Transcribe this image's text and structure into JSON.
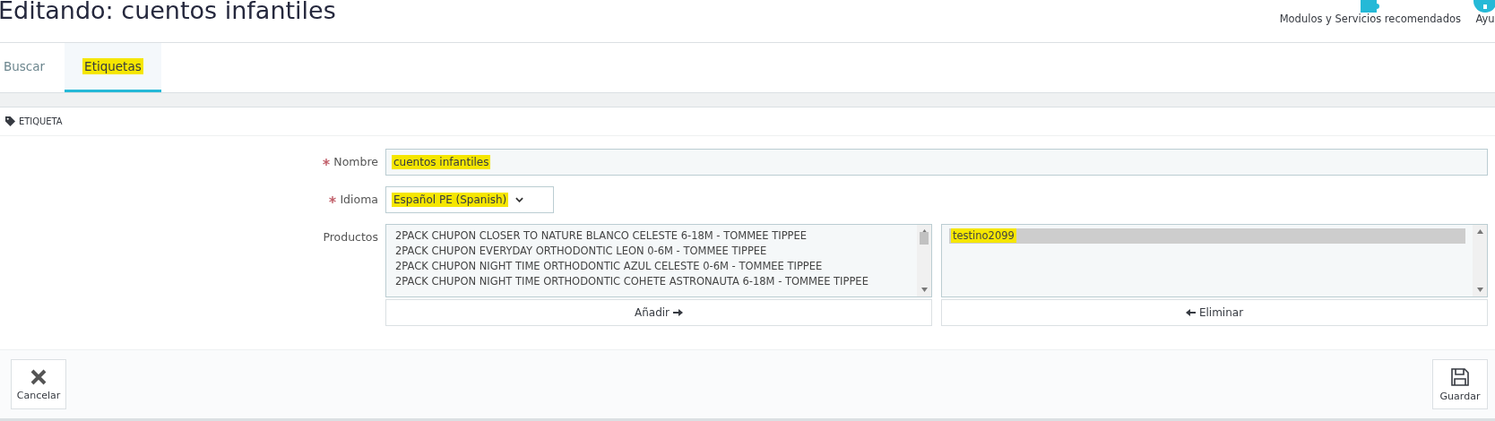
{
  "page_title": "Editando: cuentos infantiles",
  "toolbar": [
    {
      "kind": "puzzle",
      "label": "Modulos y Servicios recomendados"
    },
    {
      "kind": "help",
      "label": "Ayu"
    }
  ],
  "tabs": [
    {
      "label": "Buscar",
      "selected": false,
      "highlighted": false
    },
    {
      "label": "Etiquetas",
      "selected": true,
      "highlighted": true
    }
  ],
  "panel": {
    "heading": "ETIQUETA",
    "name_field": {
      "label": "Nombre",
      "required": true,
      "value": "cuentos infantiles",
      "highlighted": true
    },
    "language_field": {
      "label": "Idioma",
      "required": true,
      "value": "Español PE (Spanish)",
      "highlighted": true
    },
    "products": {
      "label": "Productos",
      "available": [
        {
          "text": "2PACK CHUPON CLOSER TO NATURE BLANCO CELESTE 6-18M - TOMMEE TIPPEE",
          "selected": false
        },
        {
          "text": "2PACK CHUPON EVERYDAY ORTHODONTIC LEON 0-6M - TOMMEE TIPPEE",
          "selected": false
        },
        {
          "text": "2PACK CHUPON NIGHT TIME ORTHODONTIC AZUL CELESTE 0-6M - TOMMEE TIPPEE",
          "selected": false
        },
        {
          "text": "2PACK CHUPON NIGHT TIME ORTHODONTIC COHETE ASTRONAUTA 6-18M - TOMMEE TIPPEE",
          "selected": false
        }
      ],
      "chosen": [
        {
          "text": "testino2099",
          "selected": true,
          "highlighted": true
        }
      ],
      "add_button": "Añadir",
      "remove_button": "Eliminar"
    }
  },
  "footer": {
    "cancel": "Cancelar",
    "save": "Guardar"
  }
}
